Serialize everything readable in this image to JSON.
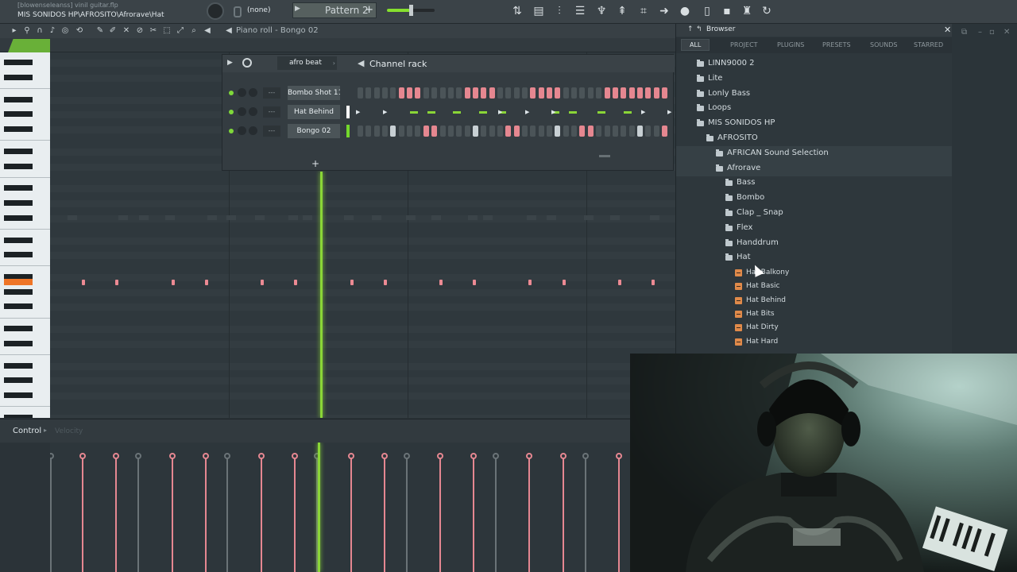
{
  "title_bar": {
    "project_name": "[blowenseleanss] vinil guitar.flp",
    "hint_path": "MIS SONIDOS HP\\AFROSITO\\Afrorave\\Hat"
  },
  "toolbar": {
    "preset_value": "(none)",
    "pattern_label": "Pattern 2",
    "master_volume": 0.5
  },
  "piano_roll": {
    "title": "Piano roll - Bongo 02",
    "control_label": "Control",
    "control_target": "Velocity"
  },
  "channel_rack": {
    "title": "Channel rack",
    "filter_group": "afro beat",
    "channels": [
      {
        "name": "Bombo Shot 11",
        "mixer_route": "---"
      },
      {
        "name": "Hat Behind",
        "mixer_route": "---"
      },
      {
        "name": "Bongo 02",
        "mixer_route": "---"
      }
    ],
    "add_label": "+"
  },
  "browser": {
    "title": "Browser",
    "tabs": [
      "ALL",
      "PROJECT",
      "PLUGINS",
      "PRESETS",
      "SOUNDS",
      "STARRED"
    ],
    "folders": [
      {
        "label": "LINN9000 2"
      },
      {
        "label": "Lite"
      },
      {
        "label": "Lonly Bass"
      },
      {
        "label": "Loops"
      },
      {
        "label": "MIS SONIDOS HP"
      },
      {
        "label": "AFROSITO"
      },
      {
        "label": "AFRICAN Sound Selection"
      },
      {
        "label": "Afrorave"
      },
      {
        "label": "Bass"
      },
      {
        "label": "Bombo"
      },
      {
        "label": "Clap _ Snap"
      },
      {
        "label": "Flex"
      },
      {
        "label": "Handdrum"
      },
      {
        "label": "Hat"
      }
    ],
    "files": [
      "Hat Balkony",
      "Hat Basic",
      "Hat Behind",
      "Hat Bits",
      "Hat Dirty",
      "Hat Hard"
    ]
  },
  "colors": {
    "accent_green": "#8ad637",
    "note_pink": "#ec8a93",
    "active_key_orange": "#ef7527"
  }
}
